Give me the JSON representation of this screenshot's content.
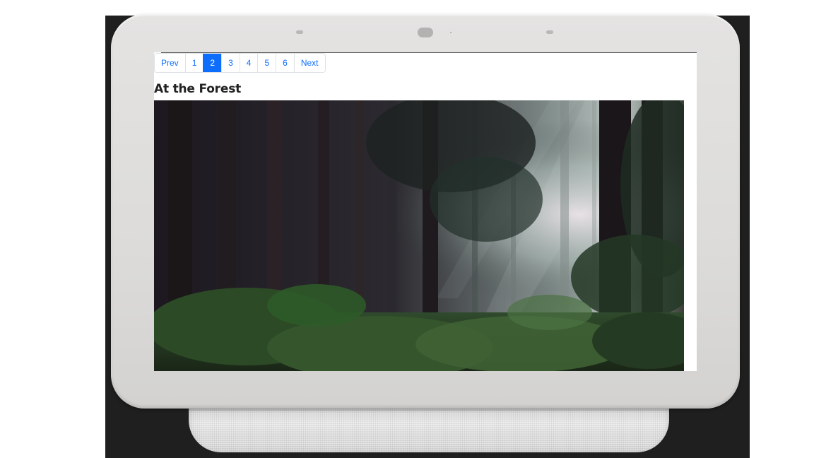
{
  "pagination": {
    "prev_label": "Prev",
    "pages": [
      "1",
      "2",
      "3",
      "4",
      "5",
      "6"
    ],
    "active_page": "2",
    "next_label": "Next"
  },
  "content": {
    "title": "At the Forest"
  },
  "colors": {
    "accent": "#0d6efd",
    "backdrop": "#1f1f20",
    "bezel": "#dcdbd9"
  },
  "icons": {
    "device": "smart-display-device",
    "image": "forest-photo"
  }
}
